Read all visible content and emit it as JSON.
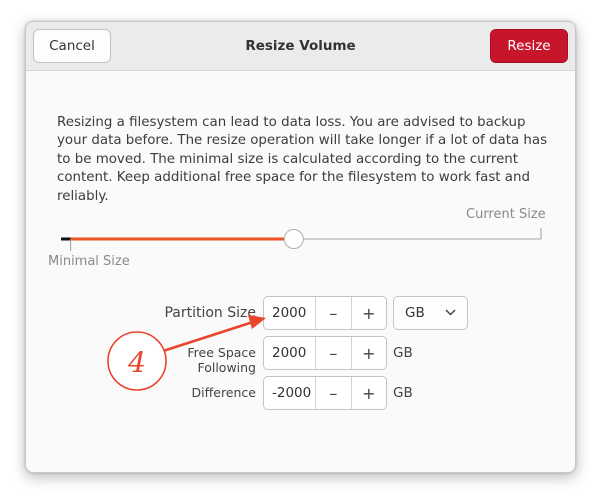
{
  "dialog": {
    "title": "Resize Volume",
    "cancel_label": "Cancel",
    "resize_label": "Resize",
    "description": "Resizing a filesystem can lead to data loss. You are advised to backup your data before. The resize operation will take longer if a lot of data has to be moved. The minimal size is calculated according to the current content. Keep additional free space for the filesystem to work fast and reliably."
  },
  "slider": {
    "current_size_label": "Current Size",
    "minimal_size_label": "Minimal Size",
    "value_fraction": 0.485,
    "minimal_fraction": 0.02,
    "accent": "#e95420"
  },
  "form": {
    "partition_size": {
      "label": "Partition Size",
      "value": "2000",
      "unit": "GB"
    },
    "free_space_following": {
      "label": "Free Space Following",
      "value": "2000",
      "unit": "GB"
    },
    "difference": {
      "label": "Difference",
      "value": "-2000",
      "unit": "GB"
    },
    "minus": "–",
    "plus": "+"
  },
  "annotation": {
    "number": "4",
    "color": "#e8452c"
  }
}
